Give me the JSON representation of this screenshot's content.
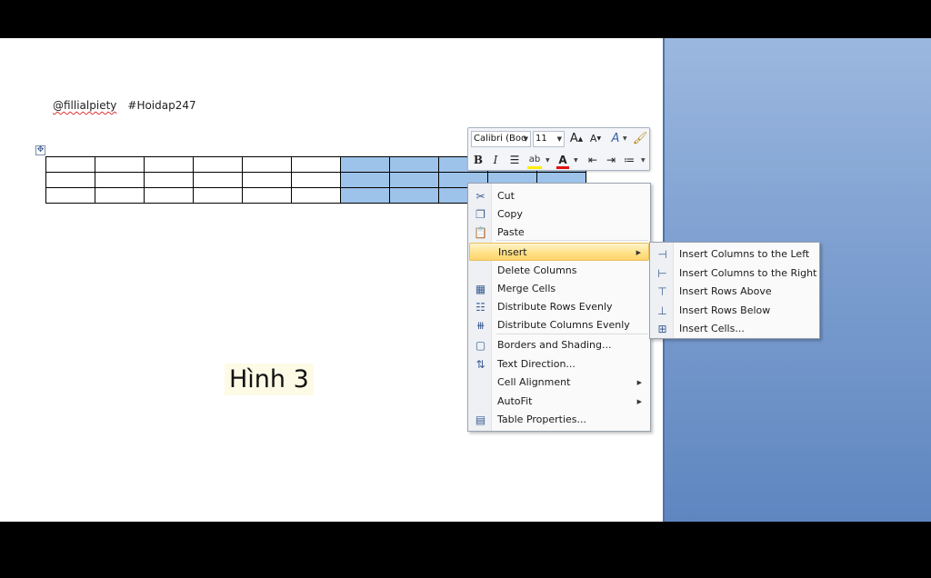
{
  "document": {
    "handle_user": "@fillialpiety",
    "handle_tag": "#Hoidap247",
    "caption": "Hình 3",
    "table": {
      "rows": 3,
      "cols": 11,
      "selected_from_col": 6
    }
  },
  "mini_toolbar": {
    "font_name": "Calibri (Boc",
    "font_size": "11",
    "bold": "B",
    "italic": "I"
  },
  "context_menu": {
    "items": [
      {
        "label": "Cut",
        "icon": "scissors-icon"
      },
      {
        "label": "Copy",
        "icon": "copy-icon"
      },
      {
        "label": "Paste",
        "icon": "paste-icon"
      },
      {
        "label": "Insert",
        "icon": "",
        "submenu": true,
        "highlighted": true
      },
      {
        "label": "Delete Columns",
        "icon": ""
      },
      {
        "label": "Merge Cells",
        "icon": "merge-cells-icon"
      },
      {
        "label": "Distribute Rows Evenly",
        "icon": "distribute-rows-icon"
      },
      {
        "label": "Distribute Columns Evenly",
        "icon": "distribute-columns-icon"
      },
      {
        "label": "Borders and Shading...",
        "icon": "borders-icon"
      },
      {
        "label": "Text Direction...",
        "icon": "text-direction-icon"
      },
      {
        "label": "Cell Alignment",
        "icon": "",
        "submenu": true
      },
      {
        "label": "AutoFit",
        "icon": "",
        "submenu": true
      },
      {
        "label": "Table Properties...",
        "icon": "table-properties-icon"
      }
    ]
  },
  "insert_submenu": {
    "items": [
      {
        "label": "Insert Columns to the Left",
        "icon": "insert-columns-left-icon"
      },
      {
        "label": "Insert Columns to the Right",
        "icon": "insert-columns-right-icon"
      },
      {
        "label": "Insert Rows Above",
        "icon": "insert-rows-above-icon"
      },
      {
        "label": "Insert Rows Below",
        "icon": "insert-rows-below-icon"
      },
      {
        "label": "Insert Cells...",
        "icon": "insert-cells-icon"
      }
    ]
  },
  "colors": {
    "selection": "#9ec3ea",
    "menu_highlight": "#ffe28a",
    "side_panel": "#7d9fd0",
    "font_color_bar": "#e01010",
    "highlighter_bar": "#ffee00"
  }
}
